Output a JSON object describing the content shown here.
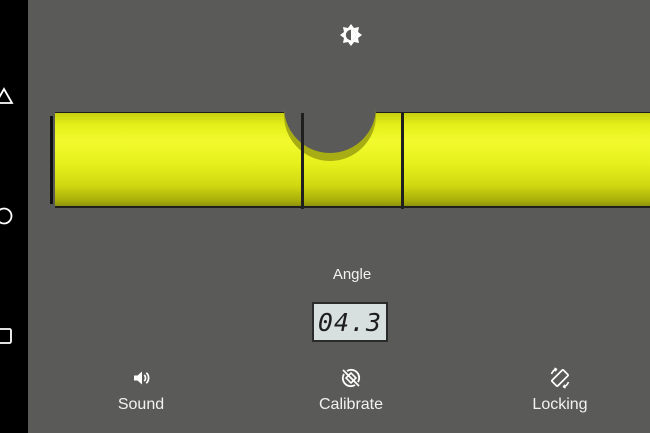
{
  "level": {
    "bubble_offset_fraction": 0.5
  },
  "angle": {
    "label": "Angle",
    "value": "04.3"
  },
  "actions": {
    "sound_label": "Sound",
    "calibrate_label": "Calibrate",
    "locking_label": "Locking"
  },
  "icons": {
    "brightness": "brightness-icon",
    "sound": "volume-icon",
    "calibrate": "calibrate-icon",
    "locking": "screen-rotation-icon",
    "back": "back-triangle-icon",
    "home": "home-circle-icon",
    "recent": "recent-apps-square-icon"
  },
  "colors": {
    "background": "#5a5a58",
    "level_fill": "#e6f01c",
    "display_bg": "#d8dfdf",
    "text": "#f2f2f2"
  }
}
